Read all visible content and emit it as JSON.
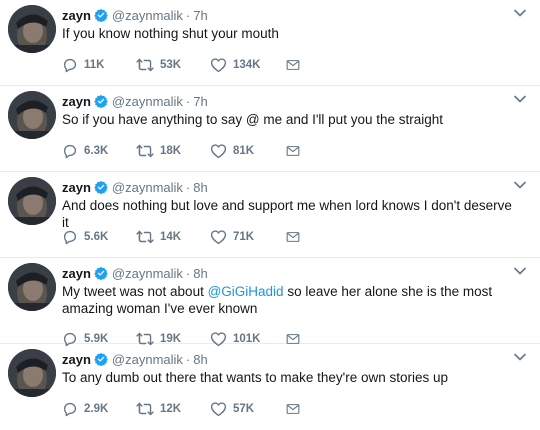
{
  "tweets": [
    {
      "name": "zayn",
      "handle": "@zaynmalik",
      "separator": "·",
      "time": "7h",
      "text_before": "If you know nothing shut your mouth",
      "mention": "",
      "text_after": "",
      "replies": "11K",
      "retweets": "53K",
      "likes": "134K"
    },
    {
      "name": "zayn",
      "handle": "@zaynmalik",
      "separator": "·",
      "time": "7h",
      "text_before": "So if you have anything to say @ me and I'll put you the straight",
      "mention": "",
      "text_after": "",
      "replies": "6.3K",
      "retweets": "18K",
      "likes": "81K"
    },
    {
      "name": "zayn",
      "handle": "@zaynmalik",
      "separator": "·",
      "time": "8h",
      "text_before": "And does nothing but love and support me when lord knows I don't deserve it",
      "mention": "",
      "text_after": "",
      "replies": "5.6K",
      "retweets": "14K",
      "likes": "71K"
    },
    {
      "name": "zayn",
      "handle": "@zaynmalik",
      "separator": "·",
      "time": "8h",
      "text_before": "My tweet was not about ",
      "mention": "@GiGiHadid",
      "text_after": " so leave her alone she is the most amazing woman I've ever known",
      "replies": "5.9K",
      "retweets": "19K",
      "likes": "101K"
    },
    {
      "name": "zayn",
      "handle": "@zaynmalik",
      "separator": "·",
      "time": "8h",
      "text_before": "To any dumb out there that wants to make they're own stories up",
      "mention": "",
      "text_after": "",
      "replies": "2.9K",
      "retweets": "12K",
      "likes": "57K"
    }
  ],
  "colors": {
    "verified": "#1da1f2",
    "secondary_text": "#657786",
    "mention": "#1b95e0",
    "primary_text": "#14171a"
  },
  "icons": {
    "reply": "reply-icon",
    "retweet": "retweet-icon",
    "like": "heart-icon",
    "dm": "envelope-icon",
    "more": "chevron-down-icon",
    "verified": "verified-badge-icon"
  }
}
